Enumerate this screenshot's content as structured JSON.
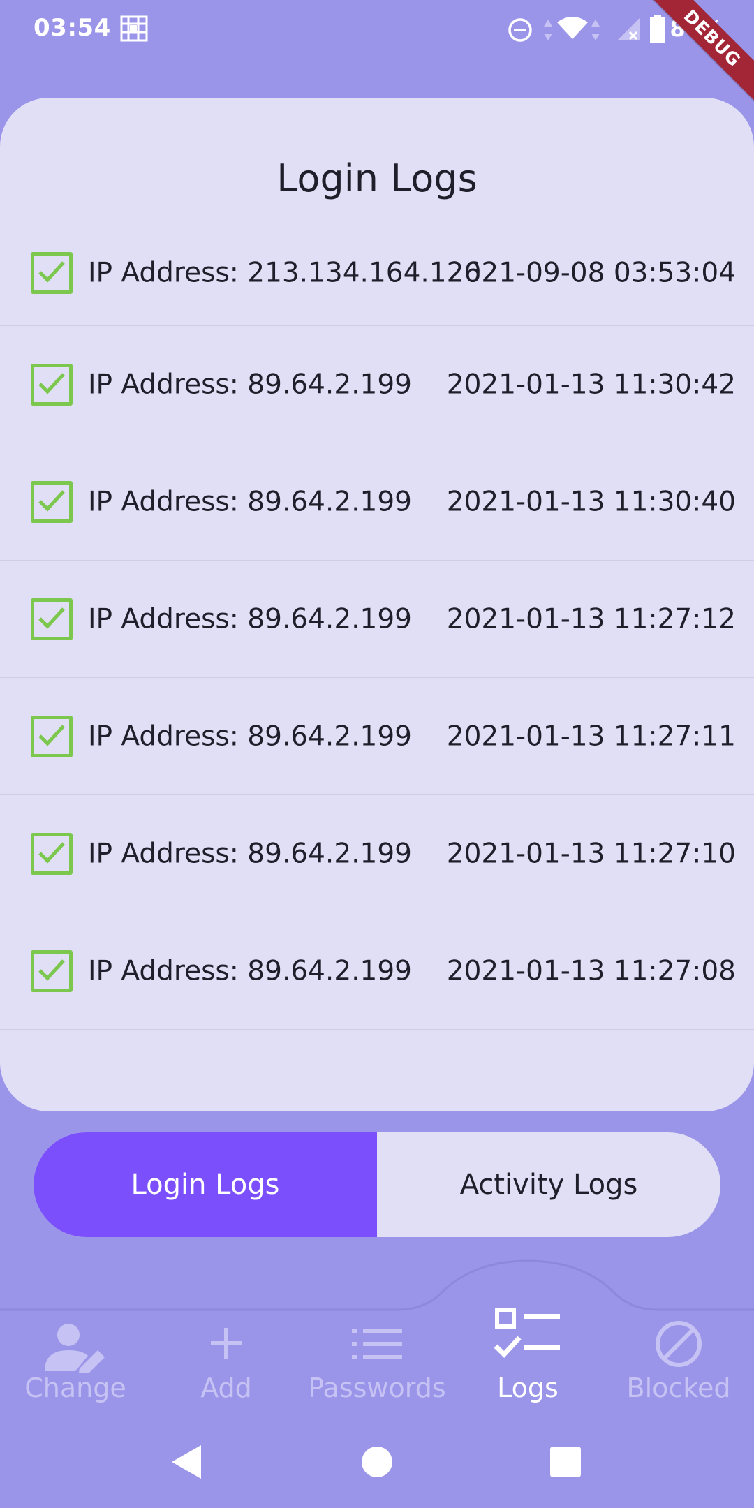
{
  "status_bar": {
    "time": "03:54",
    "battery": "84%",
    "debug_banner": "DEBUG"
  },
  "card": {
    "title": "Login Logs"
  },
  "logs": [
    {
      "ip": "IP Address: 213.134.164.126",
      "time": "2021-09-08 03:53:04"
    },
    {
      "ip": "IP Address: 89.64.2.199",
      "time": "2021-01-13 11:30:42"
    },
    {
      "ip": "IP Address: 89.64.2.199",
      "time": "2021-01-13 11:30:40"
    },
    {
      "ip": "IP Address: 89.64.2.199",
      "time": "2021-01-13 11:27:12"
    },
    {
      "ip": "IP Address: 89.64.2.199",
      "time": "2021-01-13 11:27:11"
    },
    {
      "ip": "IP Address: 89.64.2.199",
      "time": "2021-01-13 11:27:10"
    },
    {
      "ip": "IP Address: 89.64.2.199",
      "time": "2021-01-13 11:27:08"
    }
  ],
  "segment": {
    "login_label": "Login Logs",
    "activity_label": "Activity Logs"
  },
  "nav": {
    "items": [
      {
        "label": "Change",
        "icon": "user-edit-icon"
      },
      {
        "label": "Add",
        "icon": "plus-icon"
      },
      {
        "label": "Passwords",
        "icon": "list-icon"
      },
      {
        "label": "Logs",
        "icon": "checklist-icon"
      },
      {
        "label": "Blocked",
        "icon": "block-icon"
      }
    ],
    "active": "Logs"
  },
  "colors": {
    "background": "#9b95e9",
    "card": "#e1dff6",
    "accent": "#7b4ffb",
    "check": "#7cc74d",
    "debug": "#a32637"
  }
}
